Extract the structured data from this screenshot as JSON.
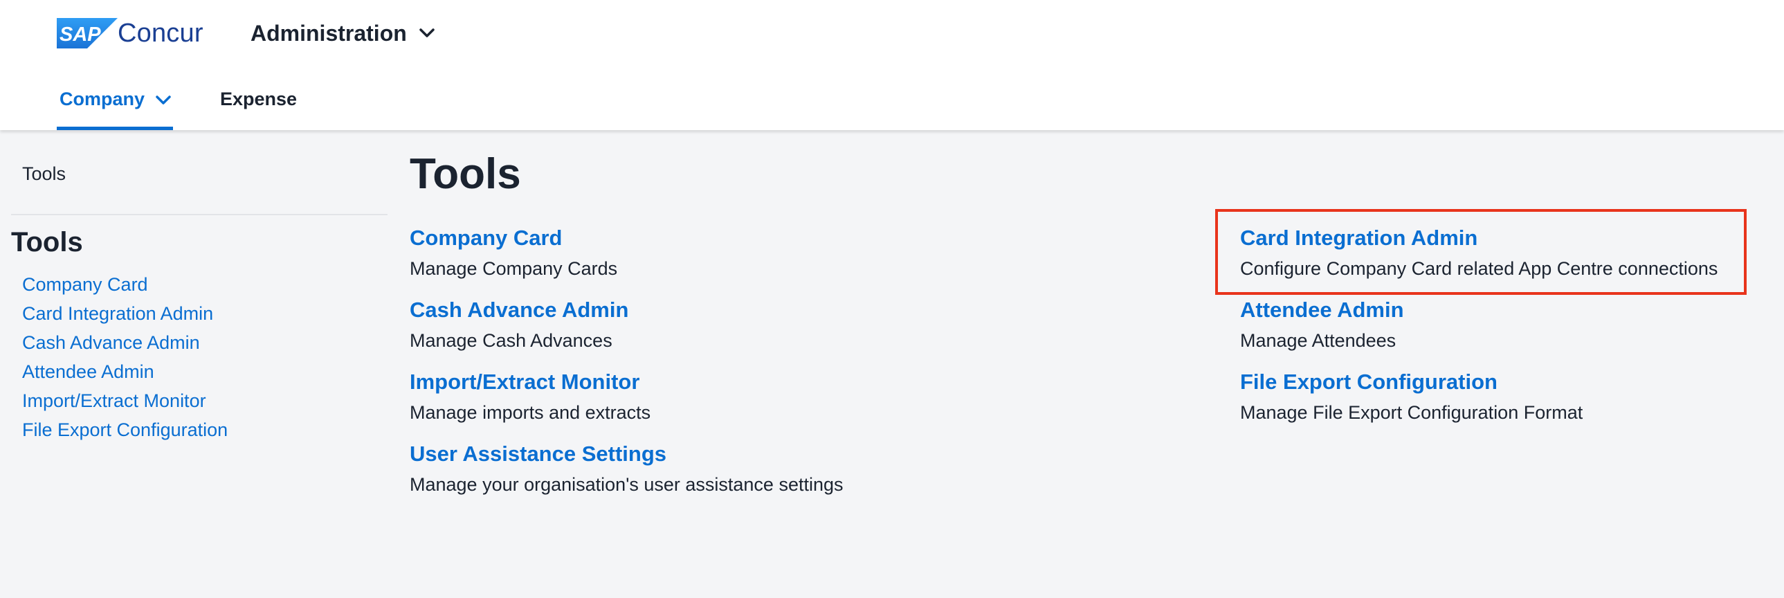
{
  "brand": {
    "mark_text": "SAP",
    "name": "Concur",
    "colors": {
      "sap_blue": "#1f8ce8",
      "concur_navy": "#1a3f93"
    }
  },
  "header": {
    "admin_menu_label": "Administration",
    "admin_menu_icon": "chevron-down-icon"
  },
  "nav": {
    "tabs": [
      {
        "label": "Company",
        "active": true,
        "icon": "chevron-down-icon"
      },
      {
        "label": "Expense",
        "active": false
      }
    ]
  },
  "sidebar": {
    "breadcrumb": "Tools",
    "heading": "Tools",
    "items": [
      {
        "label": "Company Card"
      },
      {
        "label": "Card Integration Admin"
      },
      {
        "label": "Cash Advance Admin"
      },
      {
        "label": "Attendee Admin"
      },
      {
        "label": "Import/Extract Monitor"
      },
      {
        "label": "File Export Configuration"
      }
    ]
  },
  "main": {
    "title": "Tools",
    "tools": [
      {
        "title": "Company Card",
        "description": "Manage Company Cards"
      },
      {
        "title": "Cash Advance Admin",
        "description": "Manage Cash Advances"
      },
      {
        "title": "Import/Extract Monitor",
        "description": "Manage imports and extracts"
      },
      {
        "title": "User Assistance Settings",
        "description": "Manage your organisation's user assistance settings"
      },
      {
        "title": "Card Integration Admin",
        "description": "Configure Company Card related App Centre connections",
        "highlighted": true
      },
      {
        "title": "Attendee Admin",
        "description": "Manage Attendees"
      },
      {
        "title": "File Export Configuration",
        "description": "Manage File Export Configuration Format"
      }
    ]
  },
  "colors": {
    "link": "#0a6ed1",
    "text": "#1b2330",
    "background": "#f4f5f7",
    "highlight": "#e8341c"
  }
}
